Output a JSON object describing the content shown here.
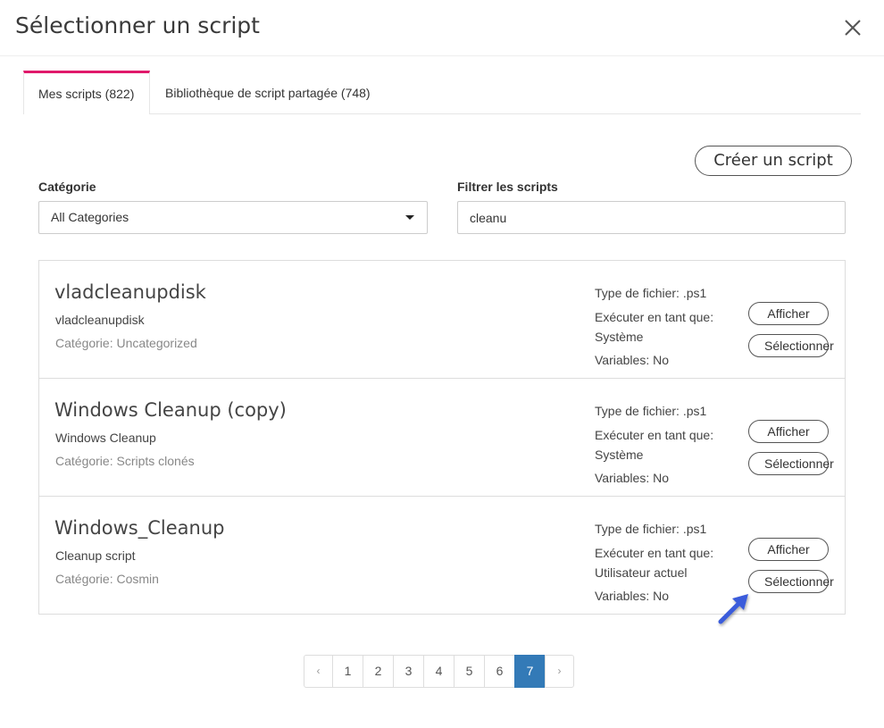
{
  "modal": {
    "title": "Sélectionner un script",
    "close_icon": "close-icon"
  },
  "tabs": [
    {
      "label": "Mes scripts (822)",
      "active": true
    },
    {
      "label": "Bibliothèque de script partagée (748)",
      "active": false
    }
  ],
  "toolbar": {
    "create_label": "Créer un script"
  },
  "filters": {
    "category_label": "Catégorie",
    "category_value": "All Categories",
    "filter_label": "Filtrer les scripts",
    "filter_value": "cleanu"
  },
  "scripts": [
    {
      "title": "vladcleanupdisk",
      "description": "vladcleanupdisk",
      "category": "Catégorie: Uncategorized",
      "file_type": "Type de fichier: .ps1",
      "run_as_label": "Exécuter en tant que:",
      "run_as_value": "Système",
      "variables": "Variables: No",
      "view_label": "Afficher",
      "select_label": "Sélectionner"
    },
    {
      "title": "Windows Cleanup (copy)",
      "description": "Windows Cleanup",
      "category": "Catégorie: Scripts clonés",
      "file_type": "Type de fichier: .ps1",
      "run_as_label": "Exécuter en tant que:",
      "run_as_value": "Système",
      "variables": "Variables: No",
      "view_label": "Afficher",
      "select_label": "Sélectionner"
    },
    {
      "title": "Windows_Cleanup",
      "description": "Cleanup script",
      "category": "Catégorie: Cosmin",
      "file_type": "Type de fichier: .ps1",
      "run_as_label": "Exécuter en tant que:",
      "run_as_value": "Utilisateur actuel",
      "variables": "Variables: No",
      "view_label": "Afficher",
      "select_label": "Sélectionner"
    }
  ],
  "pagination": {
    "prev": "‹",
    "pages": [
      "1",
      "2",
      "3",
      "4",
      "5",
      "6",
      "7"
    ],
    "current": "7",
    "next": "›"
  },
  "colors": {
    "tab_accent": "#e0196b",
    "active_page": "#337ab7",
    "pointer_arrow": "#3b5bdb"
  },
  "icons": {
    "category_dropdown": "caret-down-icon",
    "pointer": "arrow-pointer-icon"
  }
}
